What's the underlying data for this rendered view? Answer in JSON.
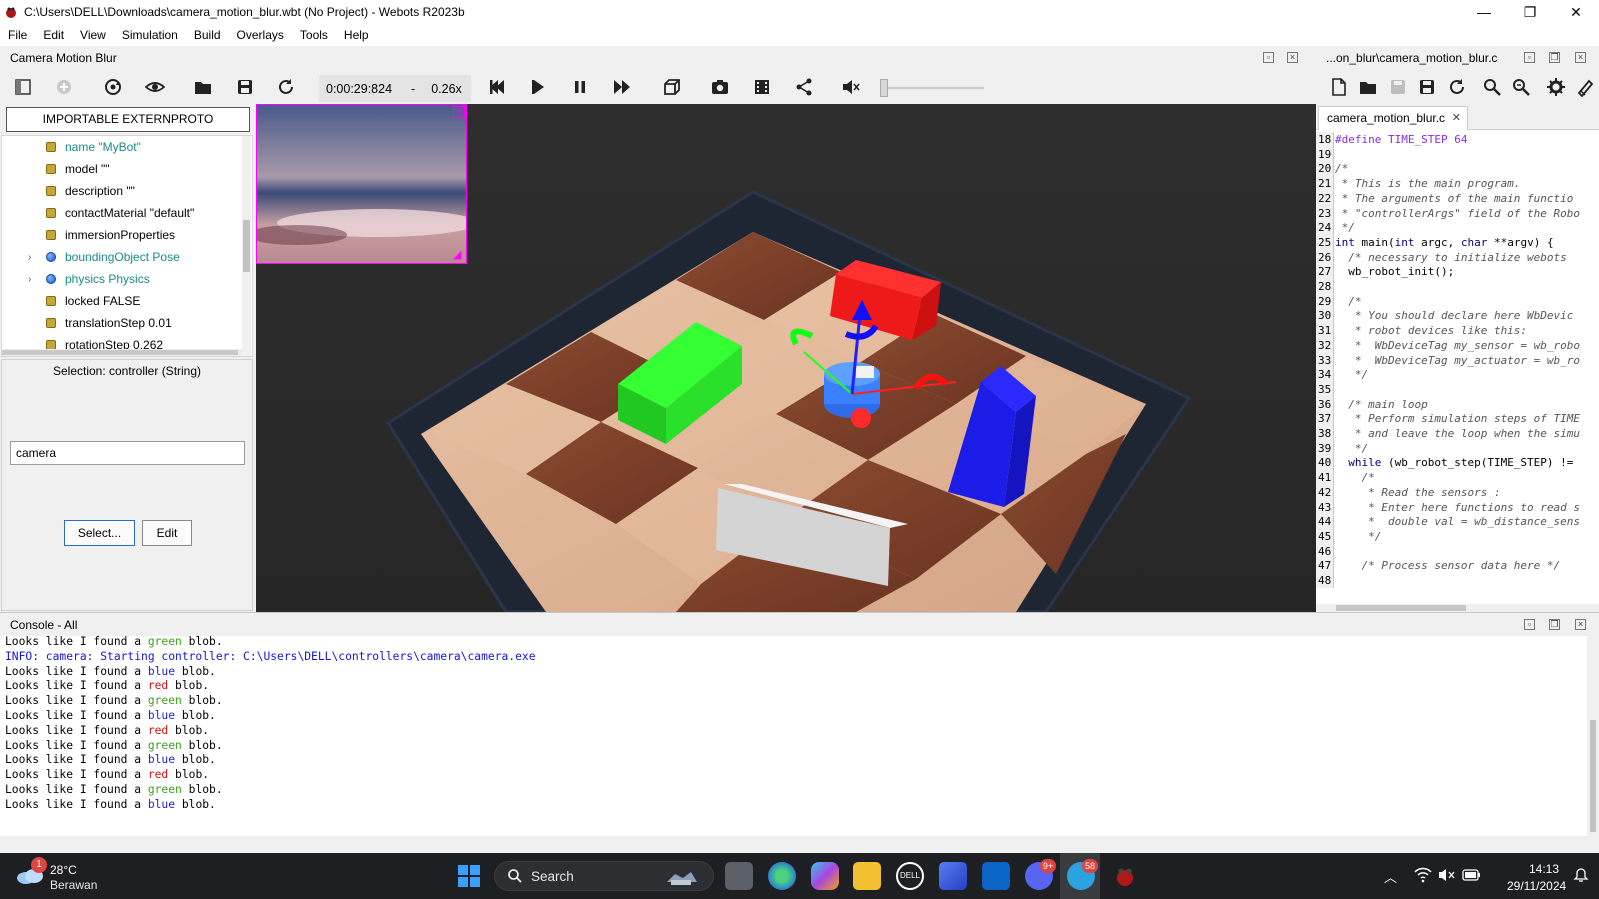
{
  "window": {
    "title": "C:\\Users\\DELL\\Downloads\\camera_motion_blur.wbt (No Project) - Webots R2023b",
    "minimize": "—",
    "maximize": "❐",
    "close": "✕"
  },
  "menu": [
    "File",
    "Edit",
    "View",
    "Simulation",
    "Build",
    "Overlays",
    "Tools",
    "Help"
  ],
  "panels": {
    "scene_title": "Camera Motion Blur",
    "editor_title": "...on_blur\\camera_motion_blur.c",
    "console_title": "Console - All"
  },
  "toolbar": {
    "time": "0:00:29:824",
    "dash": "-",
    "speed": "0.26x",
    "icons": [
      "toggle-scene-tree-icon",
      "add-node-icon",
      "reload-icon",
      "eye-icon",
      "open-icon",
      "save-icon",
      "reset-icon",
      "step-back-icon",
      "play-icon",
      "pause-icon",
      "fast-forward-icon",
      "view-icon",
      "screenshot-icon",
      "movie-icon",
      "share-icon",
      "mute-icon"
    ],
    "editor_icons": [
      "new-file-icon",
      "open-file-icon",
      "save-file-icon",
      "save-all-icon",
      "revert-icon",
      "find-icon",
      "replace-icon",
      "build-icon",
      "clean-icon"
    ]
  },
  "scene_tree": {
    "importable_button": "IMPORTABLE EXTERNPROTO",
    "rows": [
      {
        "label": "name \"MyBot\"",
        "type": "field",
        "highlight": true
      },
      {
        "label": "model \"\"",
        "type": "field"
      },
      {
        "label": "description \"\"",
        "type": "field"
      },
      {
        "label": "contactMaterial \"default\"",
        "type": "field"
      },
      {
        "label": "immersionProperties",
        "type": "field"
      },
      {
        "label": "boundingObject Pose",
        "type": "node",
        "highlight": true
      },
      {
        "label": "physics Physics",
        "type": "node",
        "highlight": true
      },
      {
        "label": "locked FALSE",
        "type": "field"
      },
      {
        "label": "translationStep 0.01",
        "type": "field"
      },
      {
        "label": "rotationStep 0.262",
        "type": "field"
      }
    ]
  },
  "field_editor": {
    "selection": "Selection: controller (String)",
    "value": "camera",
    "select_button": "Select...",
    "edit_button": "Edit"
  },
  "editor": {
    "tab": "camera_motion_blur.c",
    "lines": [
      {
        "n": "18",
        "parts": [
          [
            "pp",
            "#define TIME_STEP 64"
          ]
        ]
      },
      {
        "n": "19",
        "parts": []
      },
      {
        "n": "20",
        "parts": [
          [
            "cm",
            "/*"
          ]
        ]
      },
      {
        "n": "21",
        "parts": [
          [
            "cm",
            " * This is the main program."
          ]
        ]
      },
      {
        "n": "22",
        "parts": [
          [
            "cm",
            " * The arguments of the main functio"
          ]
        ]
      },
      {
        "n": "23",
        "parts": [
          [
            "cm",
            " * \"controllerArgs\" field of the Robo"
          ]
        ]
      },
      {
        "n": "24",
        "parts": [
          [
            "cm",
            " */"
          ]
        ]
      },
      {
        "n": "25",
        "parts": [
          [
            "kw",
            "int"
          ],
          [
            "tx",
            " main("
          ],
          [
            "kw",
            "int"
          ],
          [
            "tx",
            " argc, "
          ],
          [
            "kw",
            "char"
          ],
          [
            "tx",
            " **argv) {"
          ]
        ]
      },
      {
        "n": "26",
        "parts": [
          [
            "cm",
            "  /* necessary to initialize webots"
          ]
        ]
      },
      {
        "n": "27",
        "parts": [
          [
            "tx",
            "  wb_robot_init();"
          ]
        ]
      },
      {
        "n": "28",
        "parts": []
      },
      {
        "n": "29",
        "parts": [
          [
            "cm",
            "  /*"
          ]
        ]
      },
      {
        "n": "30",
        "parts": [
          [
            "cm",
            "   * You should declare here WbDevic"
          ]
        ]
      },
      {
        "n": "31",
        "parts": [
          [
            "cm",
            "   * robot devices like this:"
          ]
        ]
      },
      {
        "n": "32",
        "parts": [
          [
            "cm",
            "   *  WbDeviceTag my_sensor = wb_robo"
          ]
        ]
      },
      {
        "n": "33",
        "parts": [
          [
            "cm",
            "   *  WbDeviceTag my_actuator = wb_ro"
          ]
        ]
      },
      {
        "n": "34",
        "parts": [
          [
            "cm",
            "   */"
          ]
        ]
      },
      {
        "n": "35",
        "parts": []
      },
      {
        "n": "36",
        "parts": [
          [
            "cm",
            "  /* main loop"
          ]
        ]
      },
      {
        "n": "37",
        "parts": [
          [
            "cm",
            "   * Perform simulation steps of TIME"
          ]
        ]
      },
      {
        "n": "38",
        "parts": [
          [
            "cm",
            "   * and leave the loop when the simu"
          ]
        ]
      },
      {
        "n": "39",
        "parts": [
          [
            "cm",
            "   */"
          ]
        ]
      },
      {
        "n": "40",
        "parts": [
          [
            "kw",
            "  while"
          ],
          [
            "tx",
            " (wb_robot_step(TIME_STEP) !="
          ]
        ]
      },
      {
        "n": "41",
        "parts": [
          [
            "cm",
            "    /*"
          ]
        ]
      },
      {
        "n": "42",
        "parts": [
          [
            "cm",
            "     * Read the sensors :"
          ]
        ]
      },
      {
        "n": "43",
        "parts": [
          [
            "cm",
            "     * Enter here functions to read s"
          ]
        ]
      },
      {
        "n": "44",
        "parts": [
          [
            "cm",
            "     *  double val = wb_distance_sens"
          ]
        ]
      },
      {
        "n": "45",
        "parts": [
          [
            "cm",
            "     */"
          ]
        ]
      },
      {
        "n": "46",
        "parts": []
      },
      {
        "n": "47",
        "parts": [
          [
            "cm",
            "    /* Process sensor data here */"
          ]
        ]
      },
      {
        "n": "48",
        "parts": []
      }
    ]
  },
  "console": {
    "lines": [
      {
        "prefix": "Looks like I found a ",
        "color": "green",
        "word": "green",
        "suffix": " blob."
      },
      {
        "info": "INFO: camera: Starting controller: C:\\Users\\DELL\\controllers\\camera\\camera.exe"
      },
      {
        "prefix": "Looks like I found a ",
        "color": "blue",
        "word": "blue",
        "suffix": " blob."
      },
      {
        "prefix": "Looks like I found a ",
        "color": "red",
        "word": "red",
        "suffix": " blob."
      },
      {
        "prefix": "Looks like I found a ",
        "color": "green",
        "word": "green",
        "suffix": " blob."
      },
      {
        "prefix": "Looks like I found a ",
        "color": "blue",
        "word": "blue",
        "suffix": " blob."
      },
      {
        "prefix": "Looks like I found a ",
        "color": "red",
        "word": "red",
        "suffix": " blob."
      },
      {
        "prefix": "Looks like I found a ",
        "color": "green",
        "word": "green",
        "suffix": " blob."
      },
      {
        "prefix": "Looks like I found a ",
        "color": "blue",
        "word": "blue",
        "suffix": " blob."
      },
      {
        "prefix": "Looks like I found a ",
        "color": "red",
        "word": "red",
        "suffix": " blob."
      },
      {
        "prefix": "Looks like I found a ",
        "color": "green",
        "word": "green",
        "suffix": " blob."
      },
      {
        "prefix": "Looks like I found a ",
        "color": "blue",
        "word": "blue",
        "suffix": " blob."
      }
    ]
  },
  "taskbar": {
    "weather_badge": "1",
    "temperature": "28°C",
    "condition": "Berawan",
    "search_label": "Search",
    "discord_badge": "9+",
    "telegram_badge": "58",
    "time": "14:13",
    "date": "29/11/2024"
  }
}
